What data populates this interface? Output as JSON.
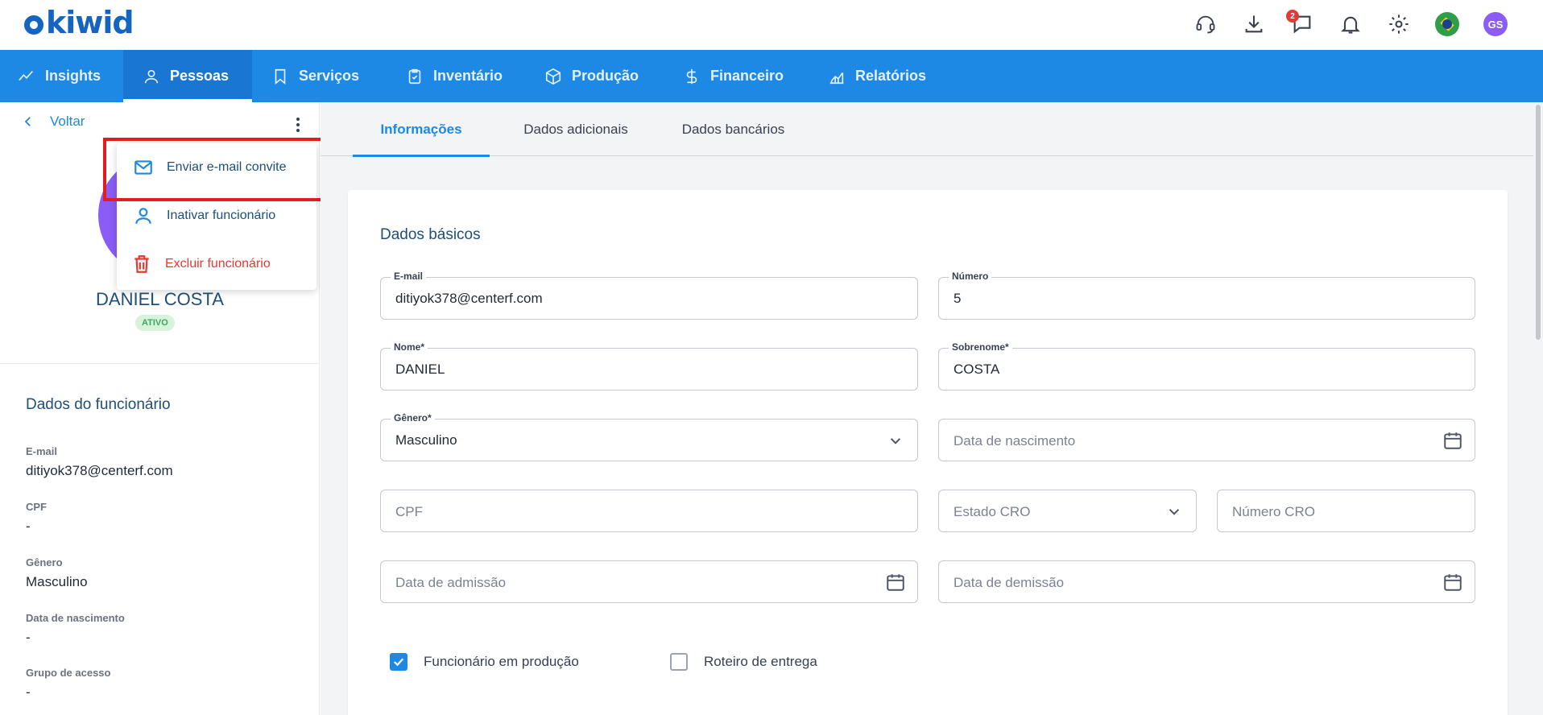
{
  "app": {
    "logo": "kiwid"
  },
  "topbar": {
    "icons": [
      {
        "name": "support-headset-icon"
      },
      {
        "name": "download-icon"
      },
      {
        "name": "chat-icon",
        "badge": "2"
      },
      {
        "name": "bell-icon"
      },
      {
        "name": "gear-icon"
      },
      {
        "name": "brazil-flag-icon"
      }
    ],
    "user_initials": "GS"
  },
  "nav": {
    "items": [
      {
        "label": "Insights",
        "icon": "trend-icon"
      },
      {
        "label": "Pessoas",
        "icon": "person-icon",
        "active": true
      },
      {
        "label": "Serviços",
        "icon": "bookmark-icon"
      },
      {
        "label": "Inventário",
        "icon": "clipboard-icon"
      },
      {
        "label": "Produção",
        "icon": "box-icon"
      },
      {
        "label": "Financeiro",
        "icon": "dollar-icon"
      },
      {
        "label": "Relatórios",
        "icon": "chart-icon"
      }
    ]
  },
  "sidebar": {
    "back_label": "Voltar",
    "employee_name": "DANIEL COSTA",
    "status": "ATIVO",
    "section_title": "Dados do funcionário",
    "fields": [
      {
        "label": "E-mail",
        "value": "ditiyok378@centerf.com"
      },
      {
        "label": "CPF",
        "value": "-"
      },
      {
        "label": "Gênero",
        "value": "Masculino"
      },
      {
        "label": "Data de nascimento",
        "value": "-"
      },
      {
        "label": "Grupo de acesso",
        "value": "-"
      }
    ]
  },
  "menu": {
    "items": [
      {
        "label": "Enviar e-mail convite",
        "icon": "mail-icon"
      },
      {
        "label": "Inativar funcionário",
        "icon": "person-icon"
      },
      {
        "label": "Excluir funcionário",
        "icon": "trash-icon",
        "danger": true
      }
    ]
  },
  "tabs": [
    {
      "label": "Informações",
      "active": true
    },
    {
      "label": "Dados adicionais"
    },
    {
      "label": "Dados bancários"
    }
  ],
  "form": {
    "title": "Dados básicos",
    "email": {
      "label": "E-mail",
      "value": "ditiyok378@centerf.com"
    },
    "numero": {
      "label": "Número",
      "value": "5"
    },
    "nome": {
      "label": "Nome*",
      "value": "DANIEL"
    },
    "sobrenome": {
      "label": "Sobrenome*",
      "value": "COSTA"
    },
    "genero": {
      "label": "Gênero*",
      "value": "Masculino"
    },
    "data_nascimento": {
      "placeholder": "Data de nascimento"
    },
    "cpf": {
      "placeholder": "CPF"
    },
    "estado_cro": {
      "placeholder": "Estado CRO"
    },
    "numero_cro": {
      "placeholder": "Número CRO"
    },
    "data_admissao": {
      "placeholder": "Data de admissão"
    },
    "data_demissao": {
      "placeholder": "Data de demissão"
    },
    "checkbox_producao": {
      "label": "Funcionário em produção",
      "checked": true
    },
    "checkbox_roteiro": {
      "label": "Roteiro de entrega",
      "checked": false
    }
  },
  "colors": {
    "primary": "#1e88e5",
    "nav_active": "#1976d2",
    "heading": "#1e4f7a",
    "danger": "#e53935",
    "highlight": "#e31b23",
    "avatar": "#8b5cf6",
    "status_bg": "#d8f3dc",
    "status_fg": "#3fa55b"
  }
}
